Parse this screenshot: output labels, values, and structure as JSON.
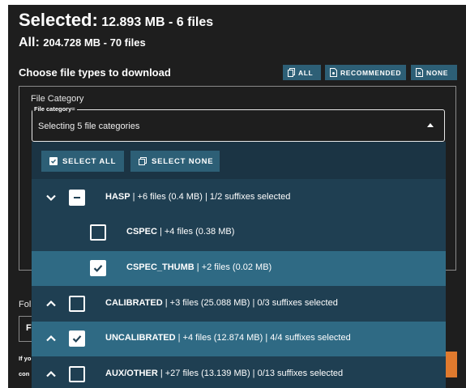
{
  "summary": {
    "selected_label": "Selected:",
    "selected_value": "12.893 MB - 6 files",
    "all_label": "All:",
    "all_value": "204.728 MB - 70 files"
  },
  "file_types": {
    "title": "Choose file types to download",
    "buttons": {
      "all": "ALL",
      "recommended": "RECOMMENDED",
      "none": "NONE"
    }
  },
  "category": {
    "section_label": "File Category",
    "field_legend": "File category",
    "field_value": "Selecting 5 file categories"
  },
  "dropdown": {
    "select_all": "SELECT ALL",
    "select_none": "SELECT NONE",
    "rows": [
      {
        "name": "HASP",
        "info": " | +6 files (0.4 MB) | 1/2 suffixes selected",
        "state": "partial",
        "chevron": "down",
        "highlighted": false,
        "child": false
      },
      {
        "name": "CSPEC",
        "info": " | +4 files (0.38 MB)",
        "state": "unchecked",
        "highlighted": false,
        "child": true
      },
      {
        "name": "CSPEC_THUMB",
        "info": " | +2 files (0.02 MB)",
        "state": "checked",
        "highlighted": true,
        "child": true
      },
      {
        "name": "CALIBRATED",
        "info": " | +3 files (25.088 MB) | 0/3 suffixes selected",
        "state": "unchecked",
        "chevron": "up",
        "highlighted": false,
        "child": false
      },
      {
        "name": "UNCALIBRATED",
        "info": " | +4 files (12.874 MB) | 4/4 suffixes selected",
        "state": "checked",
        "chevron": "up",
        "highlighted": true,
        "child": false
      },
      {
        "name": "AUX/OTHER",
        "info": " | +27 files (13.139 MB) | 0/13 suffixes selected",
        "state": "unchecked",
        "chevron": "up",
        "highlighted": false,
        "child": false
      }
    ]
  },
  "background": {
    "label_fragment": "Fol",
    "field_fragment": "F",
    "note_line1": "If yo",
    "note_line2": "con"
  },
  "colors": {
    "panel": "#1e1e1e",
    "button": "#2d5f76",
    "dropdown": "#1f3f52",
    "highlight": "#2f6a84",
    "accent_orange": "#e07a2e"
  }
}
